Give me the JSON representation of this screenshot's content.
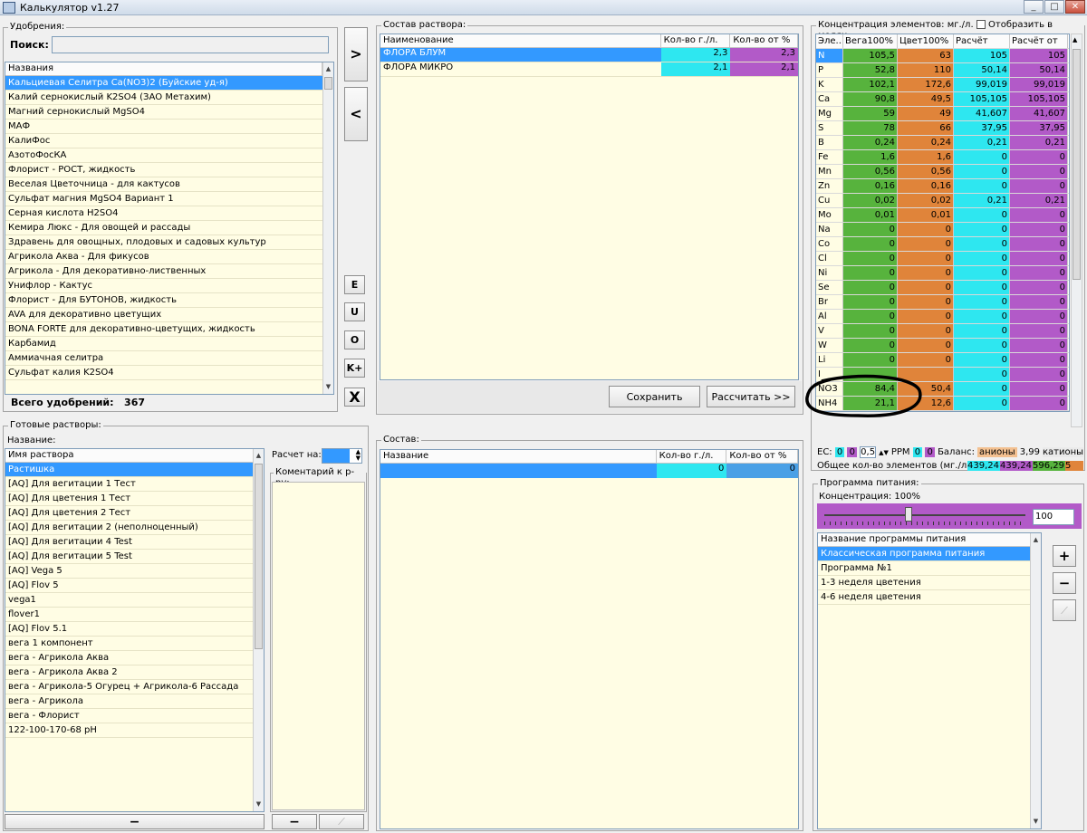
{
  "window": {
    "title": "Калькулятор v1.27"
  },
  "fertilizers": {
    "group_label": "Удобрения:",
    "search_label": "Поиск:",
    "search_value": "",
    "column": "Названия",
    "items": [
      "Кальциевая Селитра Ca(NO3)2 (Буйские уд-я)",
      "Калий  сернокислый  K2SO4 (ЗАО Метахим)",
      "Магний сернокислый MgSO4",
      "МАФ",
      "КалиФос",
      "АзотоФосКА",
      "Флорист - РОСТ, жидкость",
      "Веселая Цветочница - для кактусов",
      "Сульфат магния MgSO4 Вариант 1",
      "Серная кислота H2SO4",
      "Кемира Люкс - Для овощей и рассады",
      "Здравень для овощных, плодовых и садовых культур",
      "Агрикола Аква - Для фикусов",
      "Агрикола - Для декоративно-лиственных",
      "Унифлор - Кактус",
      "Флорист - Для БУТОНОВ, жидкость",
      "AVA для декоративно цветущих",
      "BONA FORTE для декоративно-цветущих, жидкость",
      "Карбамид",
      "Аммиачная селитра",
      "Сульфат калия K2SO4"
    ],
    "total_label": "Всего удобрений:",
    "total_value": "367"
  },
  "side_buttons": {
    "add": ">",
    "remove": "<",
    "e": "E",
    "u": "U",
    "o": "O",
    "kplus": "K+",
    "delete": "X"
  },
  "composition": {
    "group_label": "Состав раствора:",
    "columns": [
      "Наименование",
      "Кол-во г./л.",
      "Кол-во от %"
    ],
    "rows": [
      {
        "name": "ФЛОРА БЛУМ",
        "grams": "2,3",
        "percent": "2,3"
      },
      {
        "name": "ФЛОРА МИКРО",
        "grams": "2,1",
        "percent": "2,1"
      }
    ],
    "save": "Сохранить",
    "calculate": "Рассчитать >>"
  },
  "concentration": {
    "group_label": "Концентрация элементов: мг./л.",
    "moles_label": "Отобразить в молях",
    "columns": [
      "Эле...",
      "Вега100%",
      "Цвет100%",
      "Расчёт",
      "Расчёт от %"
    ],
    "rows": [
      {
        "el": "N",
        "v1": "105,5",
        "v2": "63",
        "v3": "105",
        "v4": "105"
      },
      {
        "el": "P",
        "v1": "52,8",
        "v2": "110",
        "v3": "50,14",
        "v4": "50,14"
      },
      {
        "el": "K",
        "v1": "102,1",
        "v2": "172,6",
        "v3": "99,019",
        "v4": "99,019"
      },
      {
        "el": "Ca",
        "v1": "90,8",
        "v2": "49,5",
        "v3": "105,105",
        "v4": "105,105"
      },
      {
        "el": "Mg",
        "v1": "59",
        "v2": "49",
        "v3": "41,607",
        "v4": "41,607"
      },
      {
        "el": "S",
        "v1": "78",
        "v2": "66",
        "v3": "37,95",
        "v4": "37,95"
      },
      {
        "el": "B",
        "v1": "0,24",
        "v2": "0,24",
        "v3": "0,21",
        "v4": "0,21"
      },
      {
        "el": "Fe",
        "v1": "1,6",
        "v2": "1,6",
        "v3": "0",
        "v4": "0"
      },
      {
        "el": "Mn",
        "v1": "0,56",
        "v2": "0,56",
        "v3": "0",
        "v4": "0"
      },
      {
        "el": "Zn",
        "v1": "0,16",
        "v2": "0,16",
        "v3": "0",
        "v4": "0"
      },
      {
        "el": "Cu",
        "v1": "0,02",
        "v2": "0,02",
        "v3": "0,21",
        "v4": "0,21"
      },
      {
        "el": "Mo",
        "v1": "0,01",
        "v2": "0,01",
        "v3": "0",
        "v4": "0"
      },
      {
        "el": "Na",
        "v1": "0",
        "v2": "0",
        "v3": "0",
        "v4": "0"
      },
      {
        "el": "Co",
        "v1": "0",
        "v2": "0",
        "v3": "0",
        "v4": "0"
      },
      {
        "el": "Cl",
        "v1": "0",
        "v2": "0",
        "v3": "0",
        "v4": "0"
      },
      {
        "el": "Ni",
        "v1": "0",
        "v2": "0",
        "v3": "0",
        "v4": "0"
      },
      {
        "el": "Se",
        "v1": "0",
        "v2": "0",
        "v3": "0",
        "v4": "0"
      },
      {
        "el": "Br",
        "v1": "0",
        "v2": "0",
        "v3": "0",
        "v4": "0"
      },
      {
        "el": "Al",
        "v1": "0",
        "v2": "0",
        "v3": "0",
        "v4": "0"
      },
      {
        "el": "V",
        "v1": "0",
        "v2": "0",
        "v3": "0",
        "v4": "0"
      },
      {
        "el": "W",
        "v1": "0",
        "v2": "0",
        "v3": "0",
        "v4": "0"
      },
      {
        "el": "Li",
        "v1": "0",
        "v2": "0",
        "v3": "0",
        "v4": "0"
      },
      {
        "el": "I",
        "v1": "",
        "v2": "",
        "v3": "0",
        "v4": "0"
      },
      {
        "el": "NO3",
        "v1": "84,4",
        "v2": "50,4",
        "v3": "0",
        "v4": "0"
      },
      {
        "el": "NH4",
        "v1": "21,1",
        "v2": "12,6",
        "v3": "0",
        "v4": "0"
      }
    ],
    "ec_label": "EC:",
    "ec_a": "0",
    "ec_b": "0",
    "ec_value": "0,5",
    "ppm_label": "PPM",
    "ppm_a": "0",
    "ppm_b": "0",
    "balance_label": "Баланс:",
    "anions_label": "анионы",
    "anions_value": "3,99",
    "cations_label": "катионы",
    "total_label": "Общее кол-во элементов (мг./л.):",
    "totals": [
      "439,24",
      "439,24",
      "596,29",
      "5"
    ]
  },
  "ready": {
    "group_label": "Готовые растворы:",
    "name_label": "Название:",
    "column": "Имя раствора",
    "items": [
      "Растишка",
      "[AQ] Для вегитации 1 Тест",
      "[AQ] Для цветения 1 Тест",
      "[AQ] Для цветения 2 Тест",
      "[AQ] Для вегитации 2 (неполноценный)",
      "[AQ] Для вегитации 4 Test",
      "[AQ] Для вегитации 5 Test",
      "[AQ] Vega 5",
      "[AQ] Flov 5",
      "vega1",
      "flover1",
      "[AQ] Flov 5.1",
      "вега 1 компонент",
      "вега - Агрикола Аква",
      "вега - Агрикола Аква 2",
      "вега - Агрикола-5 Огурец + Агрикола-6 Рассада",
      "вега - Агрикола",
      "вега - Флорист",
      "122-100-170-68 pH"
    ],
    "calc_label": "Расчет на:",
    "comment_label": "Коментарий к р-ру:",
    "minus": "−"
  },
  "contents": {
    "group_label": "Состав:",
    "columns": [
      "Название",
      "Кол-во г./л.",
      "Кол-во от %"
    ],
    "row": {
      "name": "",
      "grams": "0",
      "percent": "0"
    }
  },
  "program": {
    "group_label": "Программа питания:",
    "conc_label": "Концентрация: 100%",
    "conc_value": "100",
    "slider_level": 0.42,
    "column": "Название программы питания",
    "items": [
      "Классическая программа питания",
      "Программа №1",
      "1-3 неделя цветения",
      "4-6 неделя цветения"
    ],
    "plus": "+",
    "minus": "−"
  },
  "colors": {
    "selection": "#3399ff",
    "green": "#57b33d",
    "orange": "#e0843a",
    "cyan": "#2ee7f0",
    "purple": "#b25ac8"
  }
}
